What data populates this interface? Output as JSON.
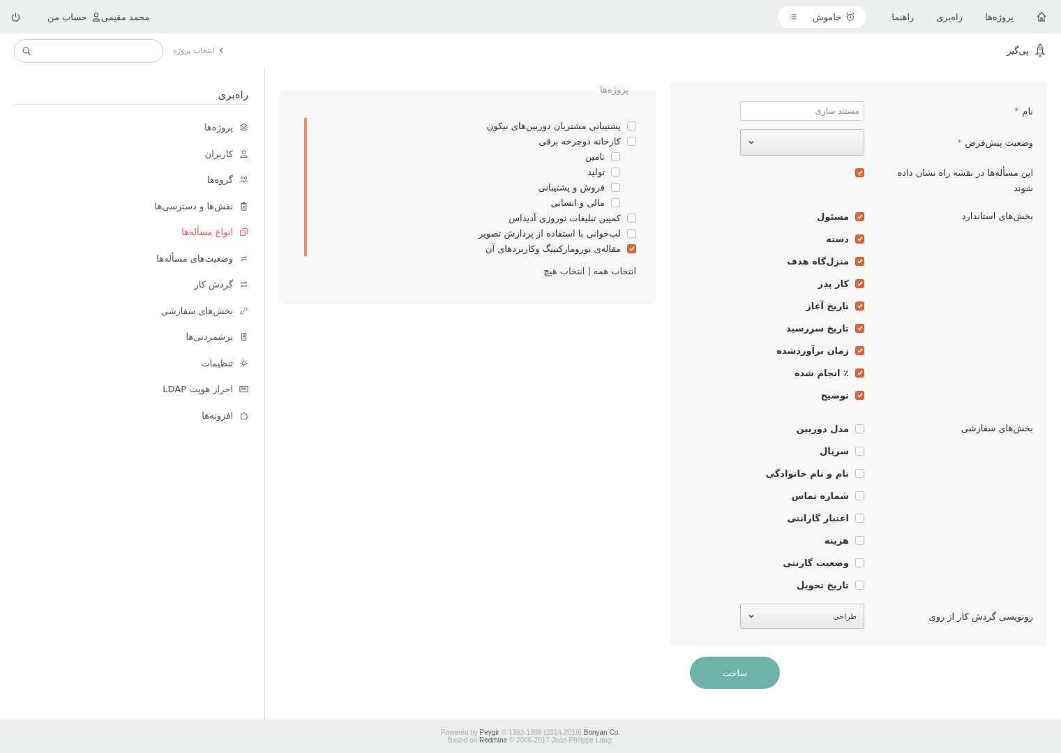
{
  "top_bar": {
    "nav": [
      "پروژه‌ها",
      "راه‌بری",
      "راهنما"
    ],
    "timer": {
      "label": "خاموش"
    },
    "user": {
      "name": "محمد مقیمی",
      "account": "حساب من"
    }
  },
  "header": {
    "brand": "پی‌گیر",
    "breadcrumb": "انتخاب پروژه"
  },
  "sidebar": {
    "title": "راه‌بری",
    "items": [
      {
        "label": "پروژه‌ها",
        "selected": false
      },
      {
        "label": "کاربران",
        "selected": false
      },
      {
        "label": "گروه‌ها",
        "selected": false
      },
      {
        "label": "نقش‌ها و دسترسی‌ها",
        "selected": false
      },
      {
        "label": "انواع مسأله‌ها",
        "selected": true
      },
      {
        "label": "وضعیت‌های مسأله‌ها",
        "selected": false
      },
      {
        "label": "گردش کار",
        "selected": false
      },
      {
        "label": "بخش‌های سفارشی",
        "selected": false
      },
      {
        "label": "برشمردنی‌ها",
        "selected": false
      },
      {
        "label": "تنظیمات",
        "selected": false
      },
      {
        "label": "احراز هویت LDAP",
        "selected": false
      },
      {
        "label": "افزونه‌ها",
        "selected": false
      }
    ]
  },
  "form": {
    "name": {
      "label": "نام",
      "required_marker": "*",
      "placeholder": "مستند سازی"
    },
    "default_status": {
      "label": "وضعیت پیش‌فرض",
      "required_marker": "*"
    },
    "roadmap": {
      "label": "این مسأله‌ها در نقشه راه نشان داده شوند",
      "checked": true
    },
    "standard_fields": {
      "label": "بخش‌های استاندارد",
      "fields": [
        {
          "label": "مسئول",
          "checked": true
        },
        {
          "label": "دسته",
          "checked": true
        },
        {
          "label": "منزل‌گاه هدف",
          "checked": true
        },
        {
          "label": "کار پدر",
          "checked": true
        },
        {
          "label": "تاریخ آغاز",
          "checked": true
        },
        {
          "label": "تاریخ سررسید",
          "checked": true
        },
        {
          "label": "زمان برآوردشده",
          "checked": true
        },
        {
          "label": "٪ انجام شده",
          "checked": true
        },
        {
          "label": "توضیح",
          "checked": true
        }
      ]
    },
    "custom_fields": {
      "label": "بخش‌های سفارشی",
      "fields": [
        {
          "label": "مدل دوربین",
          "checked": false
        },
        {
          "label": "سریال",
          "checked": false
        },
        {
          "label": "نام و نام خانوادگی",
          "checked": false
        },
        {
          "label": "شماره تماس",
          "checked": false
        },
        {
          "label": "اعتبار گارانتی",
          "checked": false
        },
        {
          "label": "هزینه",
          "checked": false
        },
        {
          "label": "وضعیت گارنتی",
          "checked": false
        },
        {
          "label": "تاریخ تحویل",
          "checked": false
        }
      ]
    },
    "workflow_copy": {
      "label": "رونویسی گردش کار از روی",
      "value": "طراحی"
    },
    "submit": "ساخت"
  },
  "projects": {
    "legend": "پروژه‌ها",
    "items": [
      {
        "label": "پشتیبانی مشتریان دوربین‌های نیکون",
        "checked": false
      },
      {
        "label": "کارخانه دوچرخه برقی",
        "checked": false,
        "children": [
          {
            "label": "تامین",
            "checked": false
          },
          {
            "label": "تولید",
            "checked": false
          },
          {
            "label": "فروش و پشتیبانی",
            "checked": false
          },
          {
            "label": "مالی و انسانی",
            "checked": false
          }
        ]
      },
      {
        "label": "کمپین تبلیغات نوروزی آدیداس",
        "checked": false
      },
      {
        "label": "لب‌خوانی با استفاده از پردازش تصویر",
        "checked": false
      },
      {
        "label": "مقاله‌ی نوروماركتینگ وکاربردهای آن",
        "checked": true
      }
    ],
    "select_all": "انتخاب همه",
    "separator": "|",
    "select_none": "انتخاب هیچ"
  },
  "footer": {
    "powered": {
      "prefix": "Powered by",
      "product_link": "Peygir",
      "copyright": "© 1393-1398 (2014-2019)",
      "company_link": "Bonyan Co."
    },
    "based": {
      "prefix": "Based on",
      "product_link": "Redmine",
      "copyright": "© 2006-2017 Jean-Philippe Lang."
    }
  }
}
